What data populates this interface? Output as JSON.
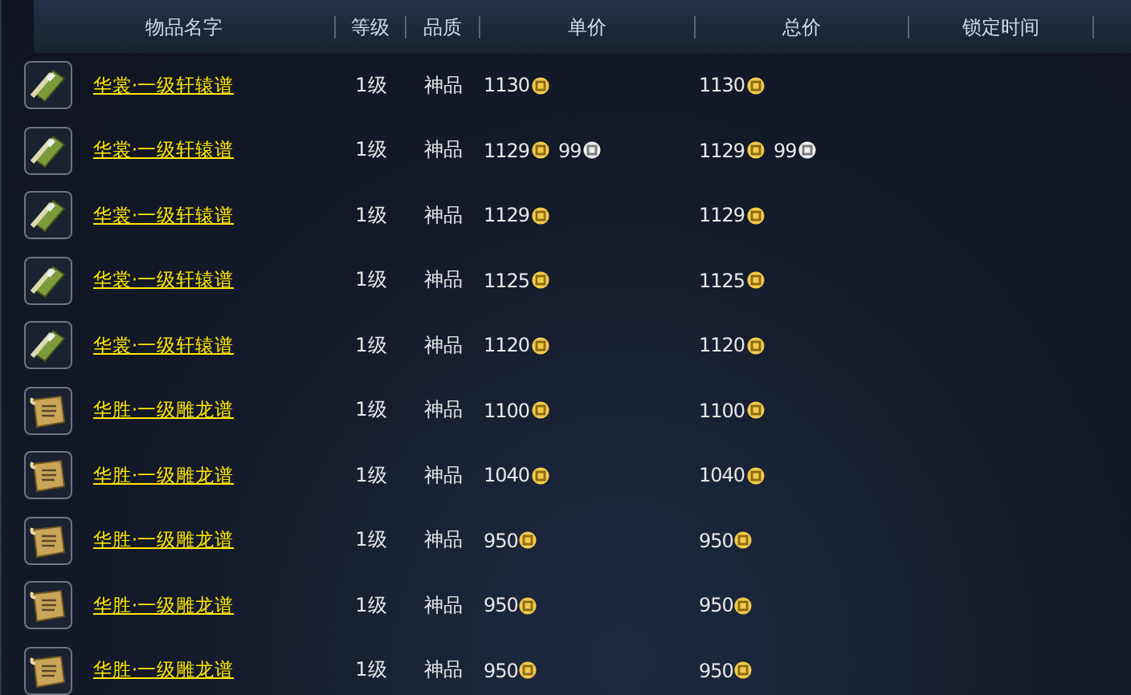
{
  "table": {
    "columns": [
      "物品名字",
      "等级",
      "品质",
      "单价",
      "总价",
      "锁定时间"
    ],
    "rows": [
      {
        "kind": "book",
        "name": "华裳·一级轩辕谱",
        "level": "1级",
        "quality": "神品",
        "unit_price": [
          {
            "amount": "1130",
            "kind": "gold"
          }
        ],
        "total_price": [
          {
            "amount": "1130",
            "kind": "gold"
          }
        ]
      },
      {
        "kind": "book",
        "name": "华裳·一级轩辕谱",
        "level": "1级",
        "quality": "神品",
        "unit_price": [
          {
            "amount": "1129",
            "kind": "gold"
          },
          {
            "amount": "99",
            "kind": "silver"
          }
        ],
        "total_price": [
          {
            "amount": "1129",
            "kind": "gold"
          },
          {
            "amount": "99",
            "kind": "silver"
          }
        ]
      },
      {
        "kind": "book",
        "name": "华裳·一级轩辕谱",
        "level": "1级",
        "quality": "神品",
        "unit_price": [
          {
            "amount": "1129",
            "kind": "gold"
          }
        ],
        "total_price": [
          {
            "amount": "1129",
            "kind": "gold"
          }
        ]
      },
      {
        "kind": "book",
        "name": "华裳·一级轩辕谱",
        "level": "1级",
        "quality": "神品",
        "unit_price": [
          {
            "amount": "1125",
            "kind": "gold"
          }
        ],
        "total_price": [
          {
            "amount": "1125",
            "kind": "gold"
          }
        ]
      },
      {
        "kind": "book",
        "name": "华裳·一级轩辕谱",
        "level": "1级",
        "quality": "神品",
        "unit_price": [
          {
            "amount": "1120",
            "kind": "gold"
          }
        ],
        "total_price": [
          {
            "amount": "1120",
            "kind": "gold"
          }
        ]
      },
      {
        "kind": "scroll",
        "name": "华胜·一级雕龙谱",
        "level": "1级",
        "quality": "神品",
        "unit_price": [
          {
            "amount": "1100",
            "kind": "gold"
          }
        ],
        "total_price": [
          {
            "amount": "1100",
            "kind": "gold"
          }
        ]
      },
      {
        "kind": "scroll",
        "name": "华胜·一级雕龙谱",
        "level": "1级",
        "quality": "神品",
        "unit_price": [
          {
            "amount": "1040",
            "kind": "gold"
          }
        ],
        "total_price": [
          {
            "amount": "1040",
            "kind": "gold"
          }
        ]
      },
      {
        "kind": "scroll",
        "name": "华胜·一级雕龙谱",
        "level": "1级",
        "quality": "神品",
        "unit_price": [
          {
            "amount": "950",
            "kind": "gold"
          }
        ],
        "total_price": [
          {
            "amount": "950",
            "kind": "gold"
          }
        ]
      },
      {
        "kind": "scroll",
        "name": "华胜·一级雕龙谱",
        "level": "1级",
        "quality": "神品",
        "unit_price": [
          {
            "amount": "950",
            "kind": "gold"
          }
        ],
        "total_price": [
          {
            "amount": "950",
            "kind": "gold"
          }
        ]
      },
      {
        "kind": "scroll",
        "name": "华胜·一级雕龙谱",
        "level": "1级",
        "quality": "神品",
        "unit_price": [
          {
            "amount": "950",
            "kind": "gold"
          }
        ],
        "total_price": [
          {
            "amount": "950",
            "kind": "gold"
          }
        ]
      }
    ]
  }
}
